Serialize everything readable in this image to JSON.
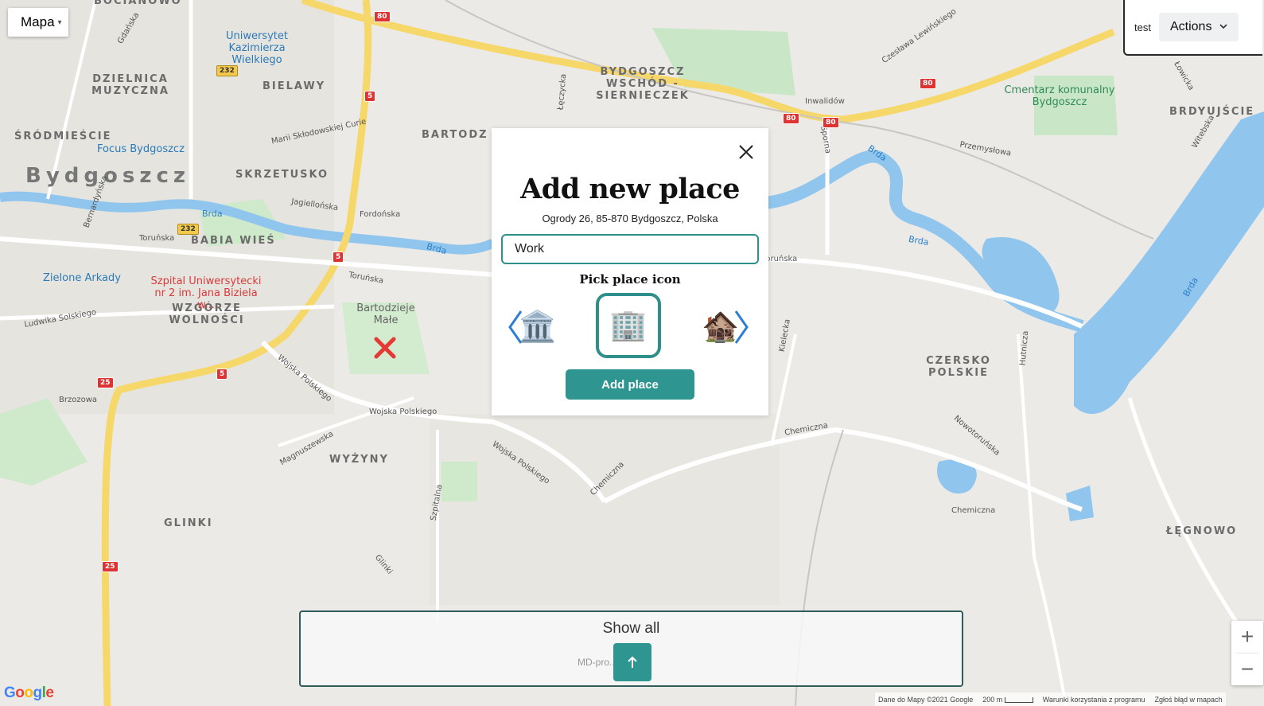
{
  "map": {
    "type_button": "Mapa",
    "city_label": "Bydgoszcz",
    "districts": [
      "DZIELNICA MUZYCZNA",
      "BIELAWY",
      "ŚRÓDMIEŚCIE",
      "SKRZETUSKO",
      "BARTODZ",
      "BABIA WIEŚ",
      "WZGÓRZE WOLNOŚCI",
      "WYŻYNY",
      "GLINKI",
      "BYDGOSZCZ WSCHÓD - SIERNIECZEK",
      "BRDYUJŚCIE",
      "CZERSKO POLSKIE",
      "ŁĘGNOWO",
      "BOCIANOWO"
    ],
    "pois": [
      "Uniwersytet Kazimierza Wielkiego",
      "Focus Bydgoszcz",
      "Zielone Arkady",
      "Szpital Uniwersytecki nr 2 im. Jana Biziela w...",
      "Bartodzieje Małe",
      "Cmentarz komunalny Bydgoszcz"
    ],
    "streets": [
      "Marii Skłodowskiej Curie",
      "Jagiellońska",
      "Fordońska",
      "Toruńska",
      "Bernardyńska",
      "Ludwika Solskiego",
      "Wojska Polskiego",
      "Brzozowa",
      "Magnuszewska",
      "Szpitalna",
      "Glinki",
      "Chemiczna",
      "Inwalidów",
      "Przemysłowa",
      "Sporna",
      "Kielecka",
      "Hutnicza",
      "Nowotoruńska",
      "Witebska",
      "Łowicka",
      "Czesława Lewińskiego",
      "Łęczycka",
      "Gdańska"
    ],
    "rivers": [
      "Brda"
    ],
    "road_numbers": [
      "80",
      "5",
      "25",
      "232"
    ],
    "behind_poi": "MD-pro... z o.o"
  },
  "user": {
    "name": "test",
    "actions_label": "Actions"
  },
  "modal": {
    "title": "Add new place",
    "address": "Ogrody 26, 85-870 Bydgoszcz, Polska",
    "name_input_value": "Work",
    "pick_icon_label": "Pick place icon",
    "icons": [
      "🏛️",
      "🏢",
      "🏚️"
    ],
    "selected_icon_index": 1,
    "add_button_label": "Add place"
  },
  "bottom_panel": {
    "show_all_label": "Show all"
  },
  "zoom": {
    "in_label": "+",
    "out_label": "−"
  },
  "footer": {
    "logo": "Google",
    "data_text": "Dane do Mapy ©2021 Google",
    "scale_text": "200 m",
    "terms_text": "Warunki korzystania z programu",
    "report_text": "Zgłoś błąd w mapach"
  },
  "colors": {
    "accent": "#2f9590",
    "river": "#90c6ee",
    "road_yellow": "#f6d86a",
    "marker": "#e53935"
  }
}
